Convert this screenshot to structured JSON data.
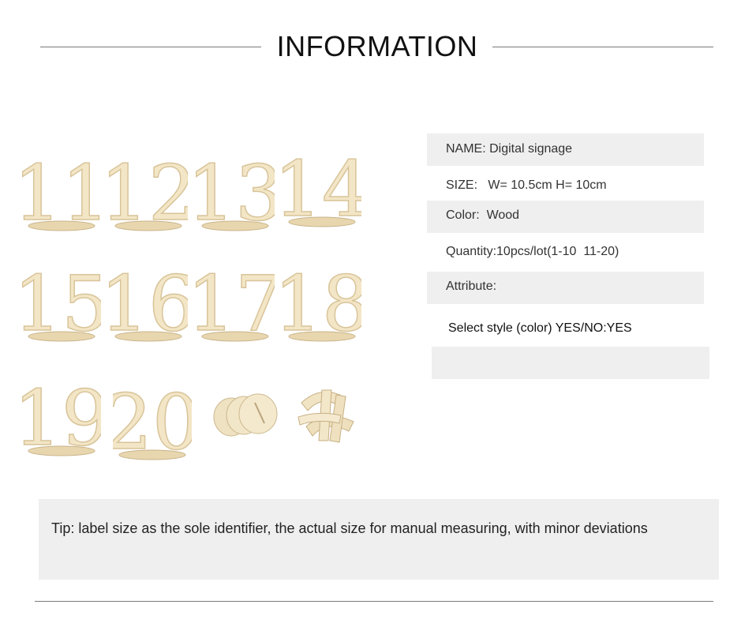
{
  "section": {
    "title": "INFORMATION"
  },
  "product_image": {
    "labels": [
      "11",
      "12",
      "13",
      "14",
      "15",
      "16",
      "17",
      "18",
      "19",
      "20"
    ]
  },
  "info": {
    "name": "NAME: Digital signage",
    "size": "SIZE:   W= 10.5cm H= 10cm",
    "color": "Color:  Wood",
    "quantity": "Quantity:10pcs/lot(1-10  11-20)",
    "attribute": "Attribute:",
    "select_style": "Select style (color) YES/NO:YES"
  },
  "tip": "Tip: label size as the sole identifier, the actual size for manual measuring, with minor deviations"
}
